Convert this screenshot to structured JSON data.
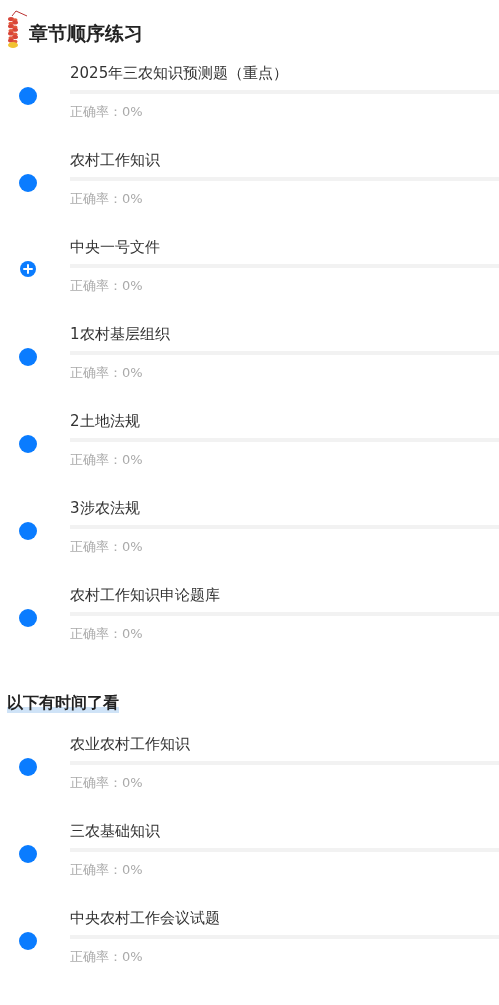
{
  "sections": [
    {
      "title": "章节顺序练习",
      "kind": "main",
      "items": [
        {
          "title": "2025年三农知识预测题（重点）",
          "kind": "dot",
          "level": 0,
          "accuracy": "正确率：0%"
        },
        {
          "title": "农村工作知识",
          "kind": "dot",
          "level": 0,
          "accuracy": "正确率：0%"
        },
        {
          "title": "中央一号文件",
          "kind": "plus",
          "level": 0,
          "accuracy": "正确率：0%"
        },
        {
          "title": "1农村基层组织",
          "kind": "dot",
          "level": 0,
          "accuracy": "正确率：0%"
        },
        {
          "title": "2土地法规",
          "kind": "dot",
          "level": 0,
          "accuracy": "正确率：0%"
        },
        {
          "title": "3涉农法规",
          "kind": "dot",
          "level": 0,
          "accuracy": "正确率：0%"
        },
        {
          "title": "农村工作知识申论题库",
          "kind": "dot",
          "level": 0,
          "accuracy": "正确率：0%"
        }
      ]
    },
    {
      "title": "以下有时间了看",
      "kind": "sub",
      "items": [
        {
          "title": "农业农村工作知识",
          "kind": "dot",
          "level": 0,
          "accuracy": "正确率：0%"
        },
        {
          "title": "三农基础知识",
          "kind": "dot",
          "level": 0,
          "accuracy": "正确率：0%"
        },
        {
          "title": "中央农村工作会议试题",
          "kind": "dot",
          "level": 0,
          "accuracy": "正确率：0%"
        }
      ]
    }
  ]
}
